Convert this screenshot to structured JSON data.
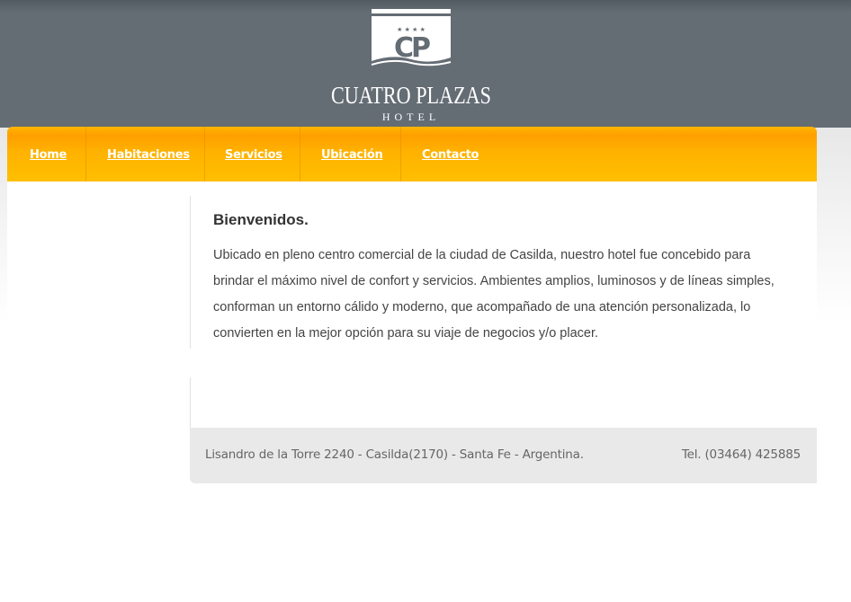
{
  "header": {
    "logo": {
      "monogram": "CP",
      "name": "CUATRO PLAZAS",
      "subtitle": "HOTEL",
      "stars": "★ ★ ★ ★"
    }
  },
  "nav": {
    "items": [
      {
        "label": "Home"
      },
      {
        "label": "Habitaciones"
      },
      {
        "label": "Servicios"
      },
      {
        "label": "Ubicación"
      },
      {
        "label": "Contacto"
      }
    ]
  },
  "main": {
    "title": "Bienvenidos.",
    "lines": [
      "Ubicado en pleno centro comercial de la ciudad de Casilda, nuestro hotel fue concebido para",
      "brindar el máximo nivel de confort y servicios.  Ambientes amplios, luminosos y de líneas simples,",
      "conforman un entorno cálido y moderno, que acompañado de una atención personalizada, lo",
      "convierten en la mejor opción para su viaje de negocios y/o placer."
    ]
  },
  "footer": {
    "address": "Lisandro de la Torre 2240 - Casilda(2170) - Santa Fe - Argentina.",
    "phone": "Tel. (03464) 425885"
  },
  "colors": {
    "header_bg": "#646c74",
    "nav_bg": "#ffb200",
    "footer_bg": "#e9e9e9",
    "text": "#444444"
  }
}
